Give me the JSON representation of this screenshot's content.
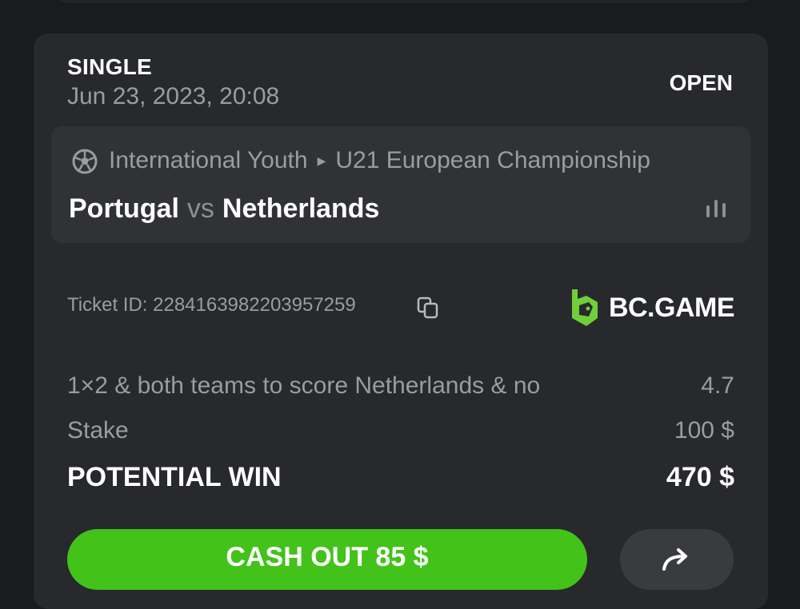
{
  "bet": {
    "type": "SINGLE",
    "date": "Jun 23, 2023, 20:08",
    "status": "OPEN"
  },
  "event": {
    "sport_icon": "soccer-ball-icon",
    "category": "International Youth",
    "league": "U21 European Championship",
    "home_team": "Portugal",
    "vs": "vs",
    "away_team": "Netherlands",
    "stats_icon": "bar-chart-icon"
  },
  "ticket": {
    "label": "Ticket ID: 2284163982203957259",
    "copy_icon": "copy-icon"
  },
  "brand": {
    "name": "BC.GAME",
    "color": "#6fce3a"
  },
  "selection": {
    "market": "1×2 & both teams to score Netherlands & no",
    "odds": "4.7"
  },
  "stake": {
    "label": "Stake",
    "value": "100 $"
  },
  "potential_win": {
    "label": "POTENTIAL WIN",
    "value": "470 $"
  },
  "actions": {
    "cashout_label": "CASH OUT 85 $",
    "share_icon": "share-arrow-icon"
  },
  "colors": {
    "background": "#1a1b1d",
    "card": "#28292c",
    "event_box": "#313236",
    "muted_text": "#9b9ca1",
    "cashout_green": "#43c21a"
  }
}
